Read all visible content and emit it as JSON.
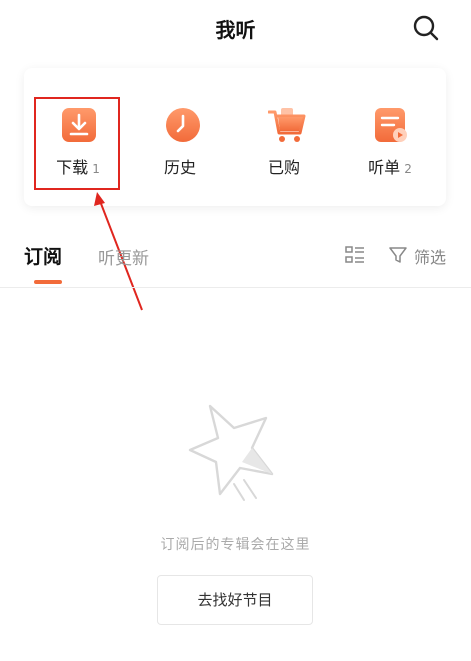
{
  "header": {
    "title": "我听",
    "search_icon": "search-icon"
  },
  "quick_actions": [
    {
      "label": "下载",
      "count": "1",
      "icon": "download-icon",
      "color": "#f26b3a"
    },
    {
      "label": "历史",
      "count": "",
      "icon": "clock-icon",
      "color": "#f26b3a"
    },
    {
      "label": "已购",
      "count": "",
      "icon": "cart-icon",
      "color": "#f26b3a"
    },
    {
      "label": "听单",
      "count": "2",
      "icon": "playlist-icon",
      "color": "#f26b3a"
    }
  ],
  "tabs": {
    "active": "订阅",
    "secondary": "听更新",
    "filter_label": "筛选",
    "accent_color": "#f26b3a"
  },
  "empty_state": {
    "message": "订阅后的专辑会在这里",
    "button_label": "去找好节目"
  },
  "annotation": {
    "box_color": "#e0261f"
  }
}
